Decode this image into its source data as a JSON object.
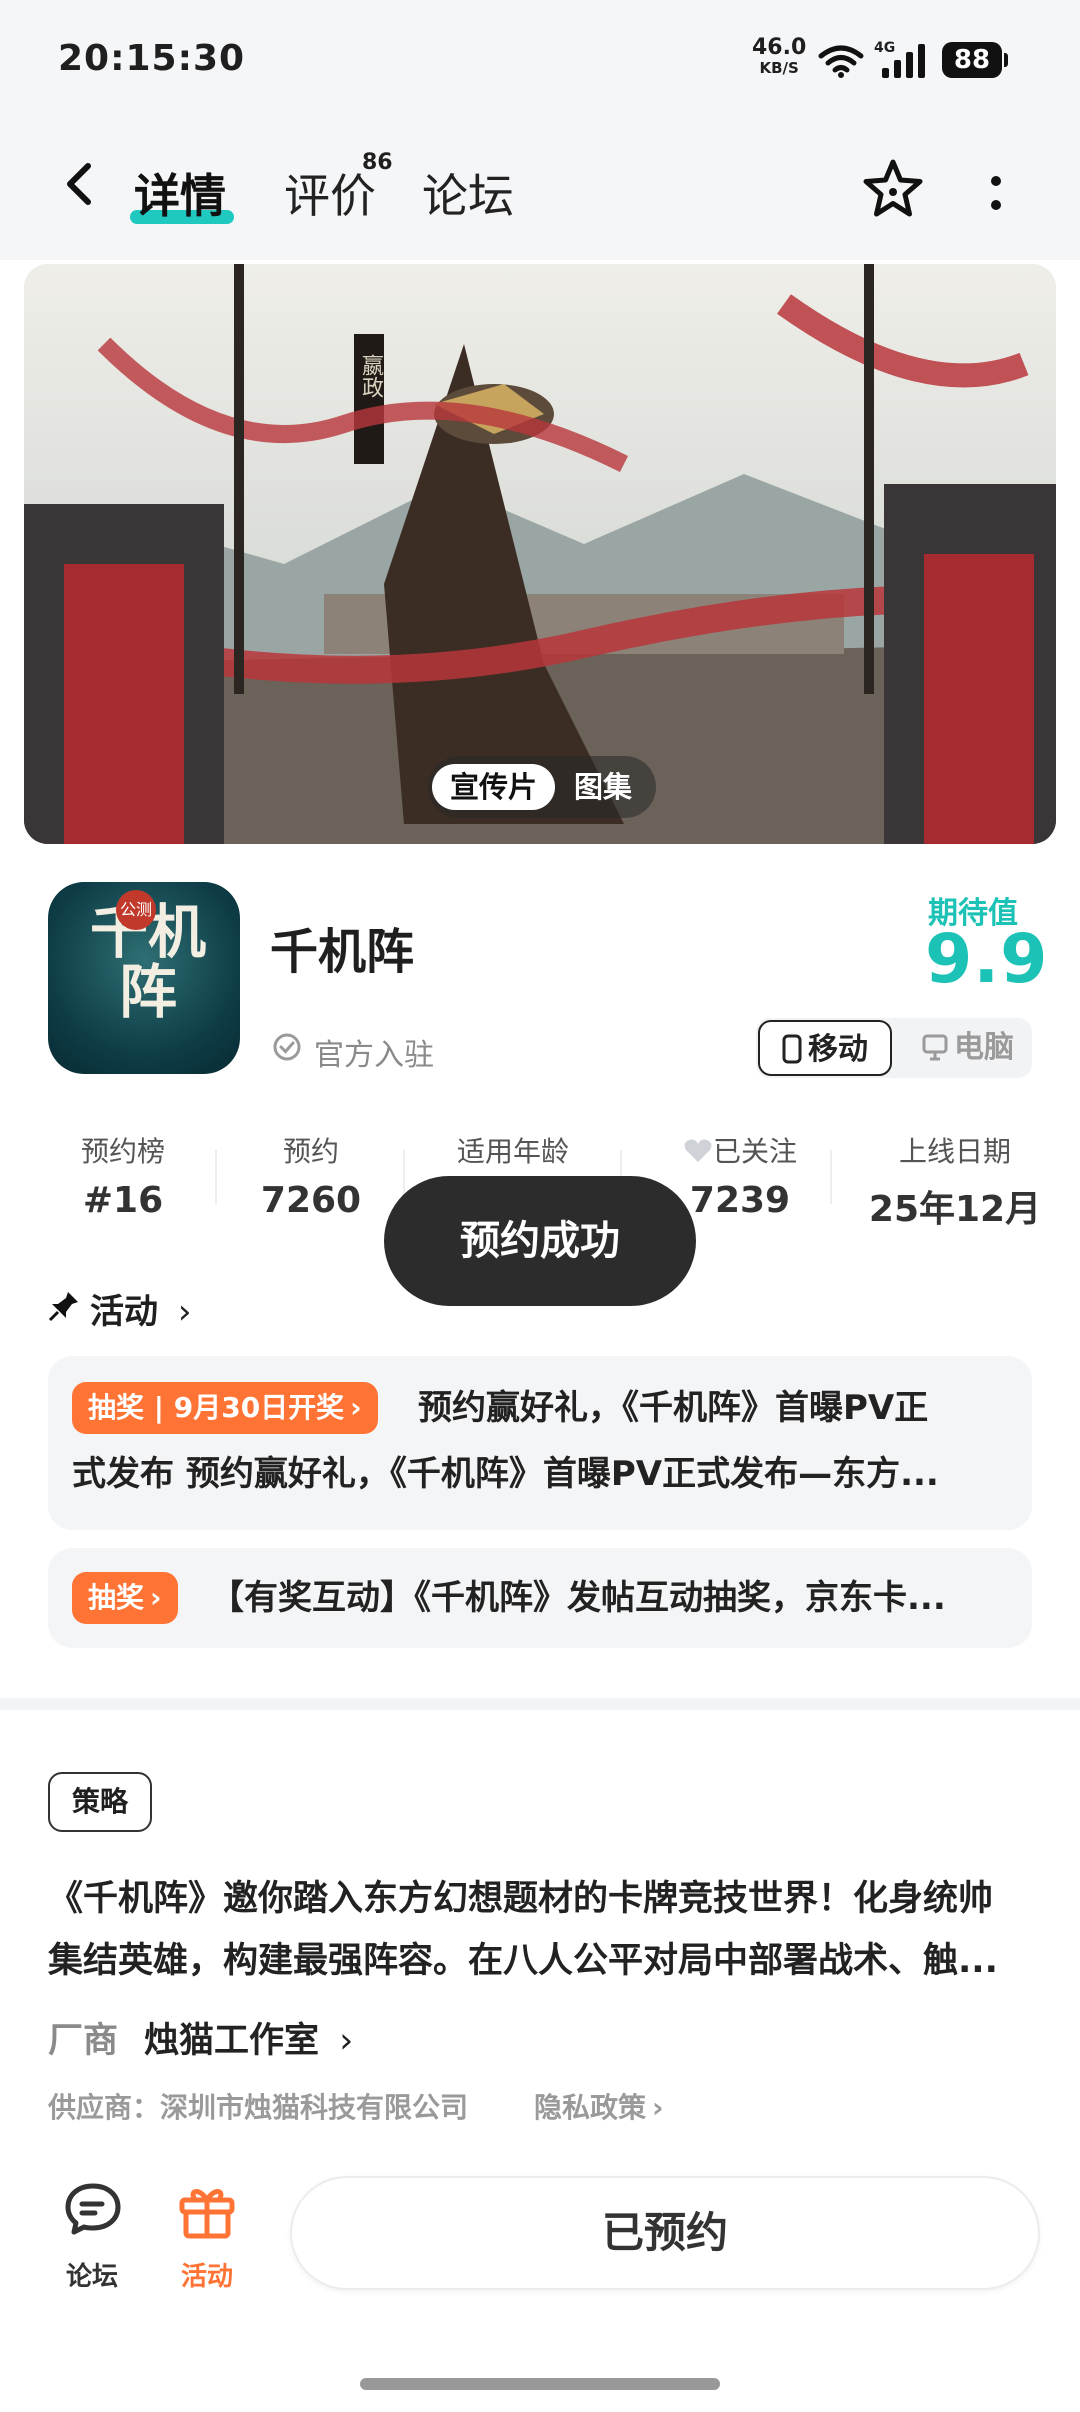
{
  "status_bar": {
    "time": "20:15:30",
    "net_speed": "46.0",
    "net_unit": "KB/S",
    "network": "4G",
    "battery": "88"
  },
  "header": {
    "tabs": [
      {
        "label": "详情",
        "active": true
      },
      {
        "label": "评价",
        "badge": "86"
      },
      {
        "label": "论坛"
      }
    ]
  },
  "banner": {
    "media_tabs": [
      "宣传片",
      "图集"
    ],
    "flag_text": "嬴政"
  },
  "app": {
    "name": "千机阵",
    "official": "官方入驻",
    "expect_label": "期待值",
    "expect_value": "9.9",
    "platforms": [
      "移动",
      "电脑"
    ],
    "icon_text": "千机阵",
    "icon_badge": "公测"
  },
  "stats": [
    {
      "label": "预约榜",
      "value": "#16"
    },
    {
      "label": "预约",
      "value": "7260"
    },
    {
      "label": "适用年龄",
      "value": ""
    },
    {
      "label": "已关注",
      "value": "7239"
    },
    {
      "label": "上线日期",
      "value": "25年12月"
    }
  ],
  "toast": "预约成功",
  "activity": {
    "title": "活动",
    "items": [
      {
        "tag": "抽奖 | 9月30日开奖",
        "line1": "预约赢好礼，《千机阵》首曝PV正",
        "line2": "式发布 预约赢好礼，《千机阵》首曝PV正式发布—东方..."
      },
      {
        "tag": "抽奖",
        "line1": "【有奖互动】《千机阵》发帖互动抽奖，京东卡..."
      }
    ]
  },
  "strategy": {
    "tag": "策略",
    "desc_line1": "《千机阵》邀你踏入东方幻想题材的卡牌竞技世界！化身统帅",
    "desc_line2": "集结英雄，构建最强阵容。在八人公平对局中部署战术、触..."
  },
  "maker": {
    "label": "厂商",
    "name": "烛猫工作室"
  },
  "supplier": "供应商：深圳市烛猫科技有限公司",
  "privacy": "隐私政策",
  "bottom": {
    "forum": "论坛",
    "activity": "活动",
    "reserve": "已预约"
  },
  "colors": {
    "accent": "#1cc2b5",
    "orange": "#ff7335",
    "toast_bg": "#2c2c2c"
  }
}
